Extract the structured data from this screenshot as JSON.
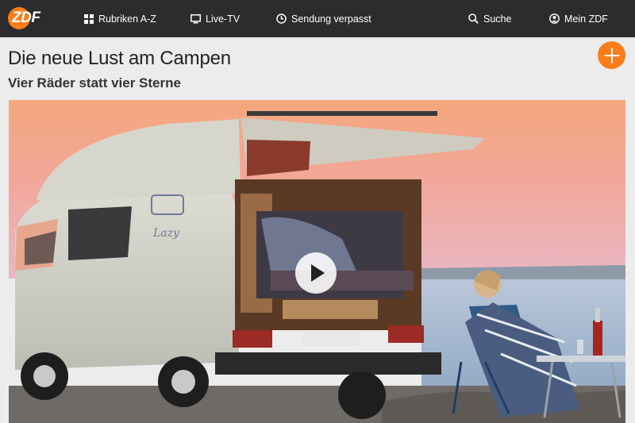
{
  "brand": {
    "logo_text": "ZDF",
    "accent_color": "#fa7d19"
  },
  "nav": {
    "items": [
      {
        "label": "Rubriken A-Z",
        "icon": "grid-icon"
      },
      {
        "label": "Live-TV",
        "icon": "tv-icon"
      },
      {
        "label": "Sendung verpasst",
        "icon": "clock-icon"
      },
      {
        "label": "Suche",
        "icon": "search-icon"
      },
      {
        "label": "Mein ZDF",
        "icon": "user-icon"
      }
    ]
  },
  "page": {
    "title": "Die neue Lust am Campen",
    "subtitle": "Vier Räder statt vier Sterne"
  },
  "video": {
    "description_icon": "play-icon",
    "van_decal": "Lazy"
  }
}
